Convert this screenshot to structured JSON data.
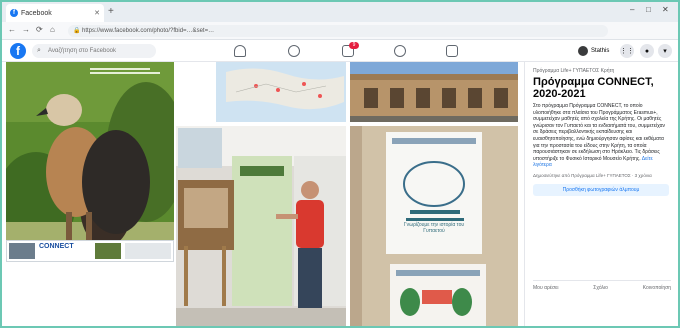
{
  "browser": {
    "tab_title": "Facebook",
    "tab_icon": "f",
    "new_tab": "+",
    "url": "https://www.facebook.com/photo/?fbid=…&set=…",
    "window_controls": [
      "–",
      "□",
      "✕"
    ]
  },
  "facebook": {
    "logo": "f",
    "search_placeholder": "Αναζήτηση στο Facebook",
    "notification_count": "9",
    "profile_name": "Stathis"
  },
  "photos": {
    "poster_brand": "CONNECT",
    "poster_text": "Γνωρίζουμε την ιστορία του Γυπαετού"
  },
  "side_panel": {
    "page_name": "Πρόγραμμα Life+ ΓΥΠΑΕΤΟΣ Κρήτη",
    "title": "Πρόγραμμα CONNECT, 2020-2021",
    "body_text": "Στο πρόγραμμα Πρόγραμμα CONNECT, το οποίο υλοποιήθηκε στα πλαίσια του Προγράμματος Erasmus+, συμμετείχαν μαθητές από σχολεία της Κρήτης. Οι μαθητές γνώρισαν τον Γυπαετό και τα ενδιαιτήματά του, συμμετείχαν σε δράσεις περιβαλλοντικής εκπαίδευσης και ευαισθητοποίησης, ενώ δημιούργησαν αφίσες και εκθέματα για την προστασία του είδους στην Κρήτη, τα οποία παρουσιάστηκαν σε εκδήλωση στο Ηράκλειο. Τις δράσεις υποστήριξε το Φυσικό Ιστορικό Μουσείο Κρήτης.",
    "link_text": "Δείτε λιγότερα",
    "meta": "Δημοσιεύτηκε από Πρόγραμμα Life+ ΓΥΠΑΕΤΟΣ · 3 χρόνια",
    "button": "Προσθήκη φωτογραφιών άλμπουμ",
    "actions": [
      "Μου αρέσει",
      "Σχόλιο",
      "Κοινοποίηση"
    ]
  },
  "colors": {
    "fb_blue": "#1877f2",
    "accent_green": "#6cc8b4",
    "badge_red": "#e41e3f"
  }
}
